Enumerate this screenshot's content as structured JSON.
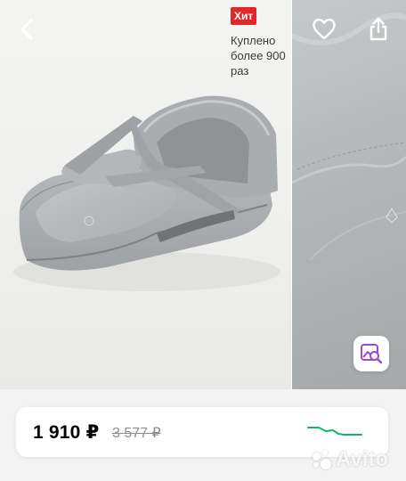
{
  "listing": {
    "badge": "Хит",
    "bought_text": "Куплено более 900 раз",
    "icons": {
      "back": "chevron-left-icon",
      "favorite": "heart-icon",
      "share": "share-icon",
      "visual_search": "image-search-icon"
    }
  },
  "price": {
    "current": "1 910 ₽",
    "old": "3 577 ₽",
    "trend_color": "#13b86b"
  },
  "watermark": {
    "text": "Avito"
  }
}
